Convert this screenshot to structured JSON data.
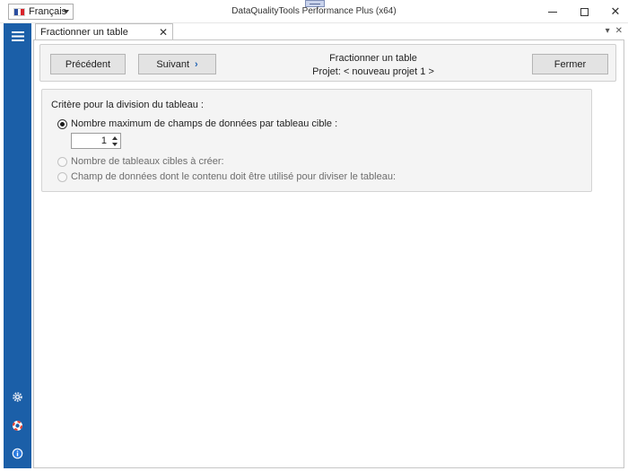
{
  "window": {
    "title": "DataQualityTools Performance Plus (x64)",
    "language": "Français",
    "minimize_icon": "minimize-icon",
    "maximize_icon": "maximize-icon",
    "close_icon": "close-icon"
  },
  "sidebar": {
    "menu_icon": "hamburger-menu-icon",
    "settings_icon": "gear-icon",
    "help_icon": "lifebuoy-icon",
    "info_icon": "info-icon",
    "color": "#1b5fa8"
  },
  "tab": {
    "label": "Fractionner un table",
    "close": "✕",
    "tools": {
      "dropdown": "▾",
      "close": "✕"
    }
  },
  "toolbar": {
    "prev_label": "Précédent",
    "next_label": "Suivant",
    "next_icon": "chevron-right-icon",
    "close_label": "Fermer",
    "title": "Fractionner un table",
    "project": "Projet: < nouveau projet 1 >"
  },
  "criteria": {
    "heading": "Critère pour la division du tableau :",
    "options": [
      {
        "label": "Nombre maximum de champs de données par tableau cible :",
        "selected": true
      },
      {
        "label": "Nombre de tableaux cibles à créer:",
        "selected": false
      },
      {
        "label": "Champ de données dont le contenu doit être utilisé pour diviser le tableau:",
        "selected": false
      }
    ],
    "max_fields_value": "1"
  }
}
